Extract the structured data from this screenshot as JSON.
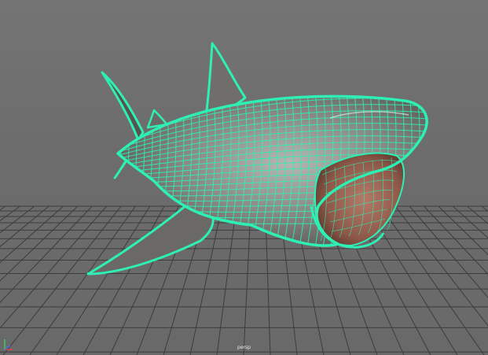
{
  "viewport": {
    "camera_name": "persp",
    "background_color": "#6e6e6e",
    "grid_color": "#3c3c3c",
    "wireframe_color": "#2ef0b4",
    "surface_color": "#8c8a86",
    "mouth_color": "#a86a5a"
  },
  "scene": {
    "object": "shark-mesh",
    "display_mode": "wireframe-on-shaded",
    "selected": true
  }
}
